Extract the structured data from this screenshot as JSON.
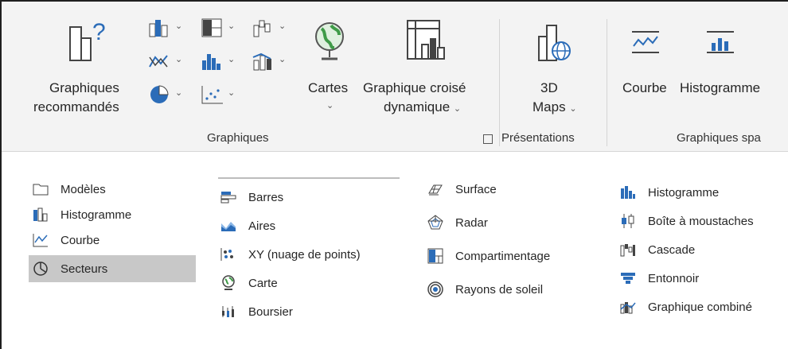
{
  "ribbon": {
    "recommended_line1": "Graphiques",
    "recommended_line2": "recommandés",
    "maps_label": "Cartes",
    "pivot_line1": "Graphique croisé",
    "pivot_line2": "dynamique",
    "threed_line1": "3D",
    "threed_line2": "Maps",
    "spark_line": "Courbe",
    "spark_hist": "Histogramme",
    "group_charts": "Graphiques",
    "group_presentations": "Présentations",
    "group_sparklines": "Graphiques spa",
    "dropdown_glyph": "⌄"
  },
  "left_menu": [
    {
      "label": "Modèles",
      "icon": "folder-icon"
    },
    {
      "label": "Histogramme",
      "icon": "column-chart-icon"
    },
    {
      "label": "Courbe",
      "icon": "line-chart-icon"
    },
    {
      "label": "Secteurs",
      "icon": "pie-chart-icon",
      "selected": true
    }
  ],
  "col1": [
    {
      "label": "Barres",
      "icon": "bar-chart-icon"
    },
    {
      "label": "Aires",
      "icon": "area-chart-icon"
    },
    {
      "label": "XY (nuage de points)",
      "icon": "scatter-chart-icon"
    },
    {
      "label": "Carte",
      "icon": "map-chart-icon"
    },
    {
      "label": "Boursier",
      "icon": "stock-chart-icon"
    }
  ],
  "col2": [
    {
      "label": "Surface",
      "icon": "surface-chart-icon"
    },
    {
      "label": "Radar",
      "icon": "radar-chart-icon"
    },
    {
      "label": "Compartimentage",
      "icon": "treemap-chart-icon"
    },
    {
      "label": "Rayons de soleil",
      "icon": "sunburst-chart-icon"
    }
  ],
  "col3": [
    {
      "label": "Histogramme",
      "icon": "histogram-chart-icon"
    },
    {
      "label": "Boîte à moustaches",
      "icon": "box-whisker-chart-icon"
    },
    {
      "label": "Cascade",
      "icon": "waterfall-chart-icon"
    },
    {
      "label": "Entonnoir",
      "icon": "funnel-chart-icon"
    },
    {
      "label": "Graphique combiné",
      "icon": "combo-chart-icon"
    }
  ],
  "colors": {
    "accent_blue": "#2b6cb8",
    "selection": "#c8c8c8",
    "ribbon_bg": "#f3f3f3",
    "green": "#3f9b48"
  }
}
